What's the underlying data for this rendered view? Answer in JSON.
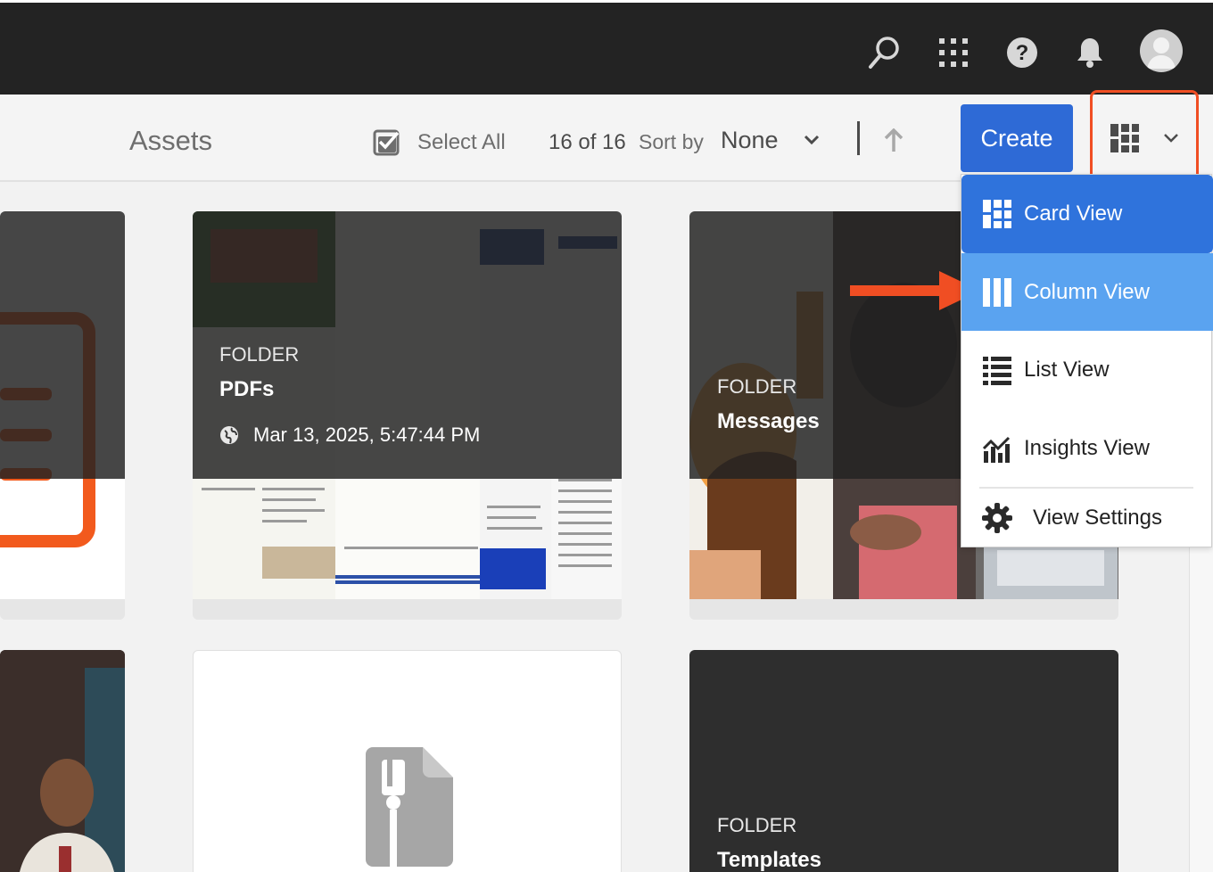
{
  "shell": {
    "icons": [
      "search-icon",
      "apps-grid-icon",
      "help-icon",
      "bell-icon",
      "avatar"
    ]
  },
  "actionbar": {
    "title": "Assets",
    "select_all": "Select All",
    "count": "16 of 16",
    "sort_by_label": "Sort by",
    "sort_value": "None",
    "create_label": "Create"
  },
  "cards": [
    {
      "kind": "FOLDER",
      "name": "PDFs",
      "date": "Mar 13, 2025, 5:47:44 PM"
    },
    {
      "kind": "FOLDER",
      "name": "Messages"
    },
    {
      "kind": "FOLDER",
      "name": "Templates"
    }
  ],
  "view_menu": {
    "items": [
      {
        "label": "Card View",
        "icon": "card-view-icon",
        "state": "selected"
      },
      {
        "label": "Column View",
        "icon": "column-view-icon",
        "state": "hover"
      },
      {
        "label": "List View",
        "icon": "list-view-icon"
      },
      {
        "label": "Insights View",
        "icon": "insights-view-icon"
      },
      {
        "label": "View Settings",
        "icon": "gear-icon"
      }
    ]
  },
  "colors": {
    "shell_bg": "#232323",
    "accent_blue": "#2e6ad6",
    "menu_selected": "#2f73dc",
    "menu_hover": "#5aa3f0",
    "highlight_red": "#f04e23"
  }
}
